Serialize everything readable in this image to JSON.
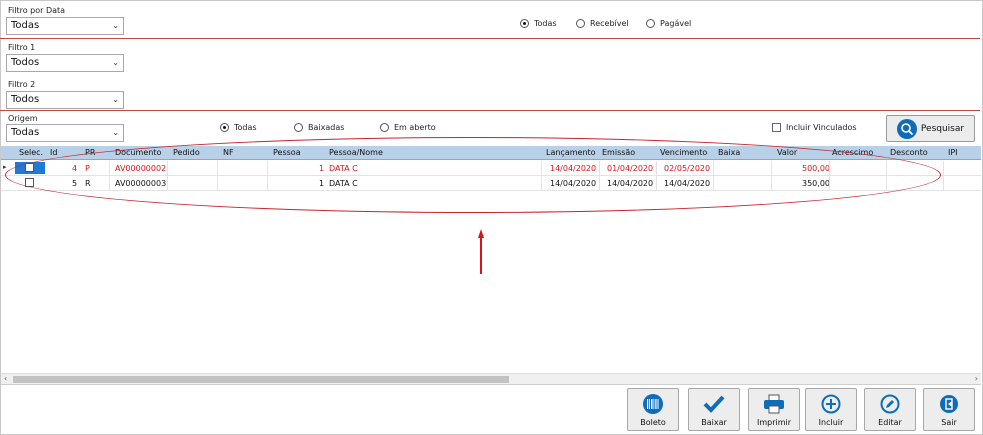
{
  "filters": {
    "filtro_data_label": "Filtro por Data",
    "filtro_data_value": "Todas",
    "filtro1_label": "Filtro 1",
    "filtro1_value": "Todos",
    "filtro2_label": "Filtro 2",
    "filtro2_value": "Todos",
    "origem_label": "Origem",
    "origem_value": "Todas"
  },
  "tipo_radios": [
    "Todas",
    "Recebível",
    "Pagável"
  ],
  "status_radios": [
    "Todas",
    "Baixadas",
    "Em aberto"
  ],
  "incluir_vinculados_label": "Incluir Vinculados",
  "pesquisar_label": "Pesquisar",
  "grid": {
    "columns": [
      "Selec.",
      "Id",
      "PR",
      "Documento",
      "Pedido",
      "NF",
      "Pessoa",
      "Pessoa/Nome",
      "Lançamento",
      "Emissão",
      "Vencimento",
      "Baixa",
      "Valor",
      "Acrescimo",
      "Desconto",
      "IPI"
    ],
    "rows": [
      {
        "id": "4",
        "pr": "P",
        "documento": "AV00000002",
        "pedido": "",
        "nf": "",
        "pessoa": "1",
        "pessoa_nome": "DATA C",
        "lancamento": "14/04/2020",
        "emissao": "01/04/2020",
        "vencimento": "02/05/2020",
        "baixa": "",
        "valor": "500,00"
      },
      {
        "id": "5",
        "pr": "R",
        "documento": "AV00000003",
        "pedido": "",
        "nf": "",
        "pessoa": "1",
        "pessoa_nome": "DATA C",
        "lancamento": "14/04/2020",
        "emissao": "14/04/2020",
        "vencimento": "14/04/2020",
        "baixa": "",
        "valor": "350,00"
      }
    ]
  },
  "actions": [
    "Boleto",
    "Baixar",
    "Imprimir",
    "Incluir",
    "Editar",
    "Sair"
  ],
  "colors": {
    "accent": "#0f6cb8",
    "row_red": "#d8141b",
    "header_bg": "#b8d0e8",
    "annotation": "#c8262c"
  }
}
